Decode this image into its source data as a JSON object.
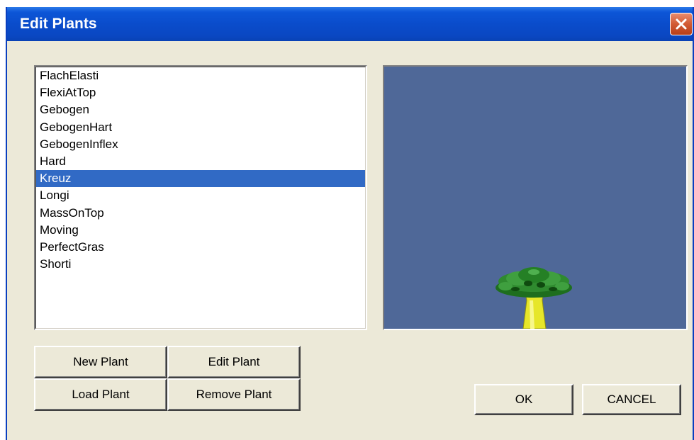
{
  "window": {
    "title": "Edit Plants"
  },
  "plant_list": {
    "items": [
      "FlachElasti",
      "FlexiAtTop",
      "Gebogen",
      "GebogenHart",
      "GebogenInflex",
      "Hard",
      "Kreuz",
      "Longi",
      "MassOnTop",
      "Moving",
      "PerfectGras",
      "Shorti"
    ],
    "selected": "Kreuz"
  },
  "buttons": {
    "new_plant": "New Plant",
    "edit_plant": "Edit Plant",
    "load_plant": "Load Plant",
    "remove_plant": "Remove Plant",
    "ok": "OK",
    "cancel": "CANCEL"
  },
  "colors": {
    "title_bar": "#0a4ccb",
    "dialog_bg": "#ece9d8",
    "selection": "#316ac5",
    "preview_bg": "#4f6898",
    "plant_canopy": "#2f8a2f",
    "plant_stem": "#e6e629"
  }
}
